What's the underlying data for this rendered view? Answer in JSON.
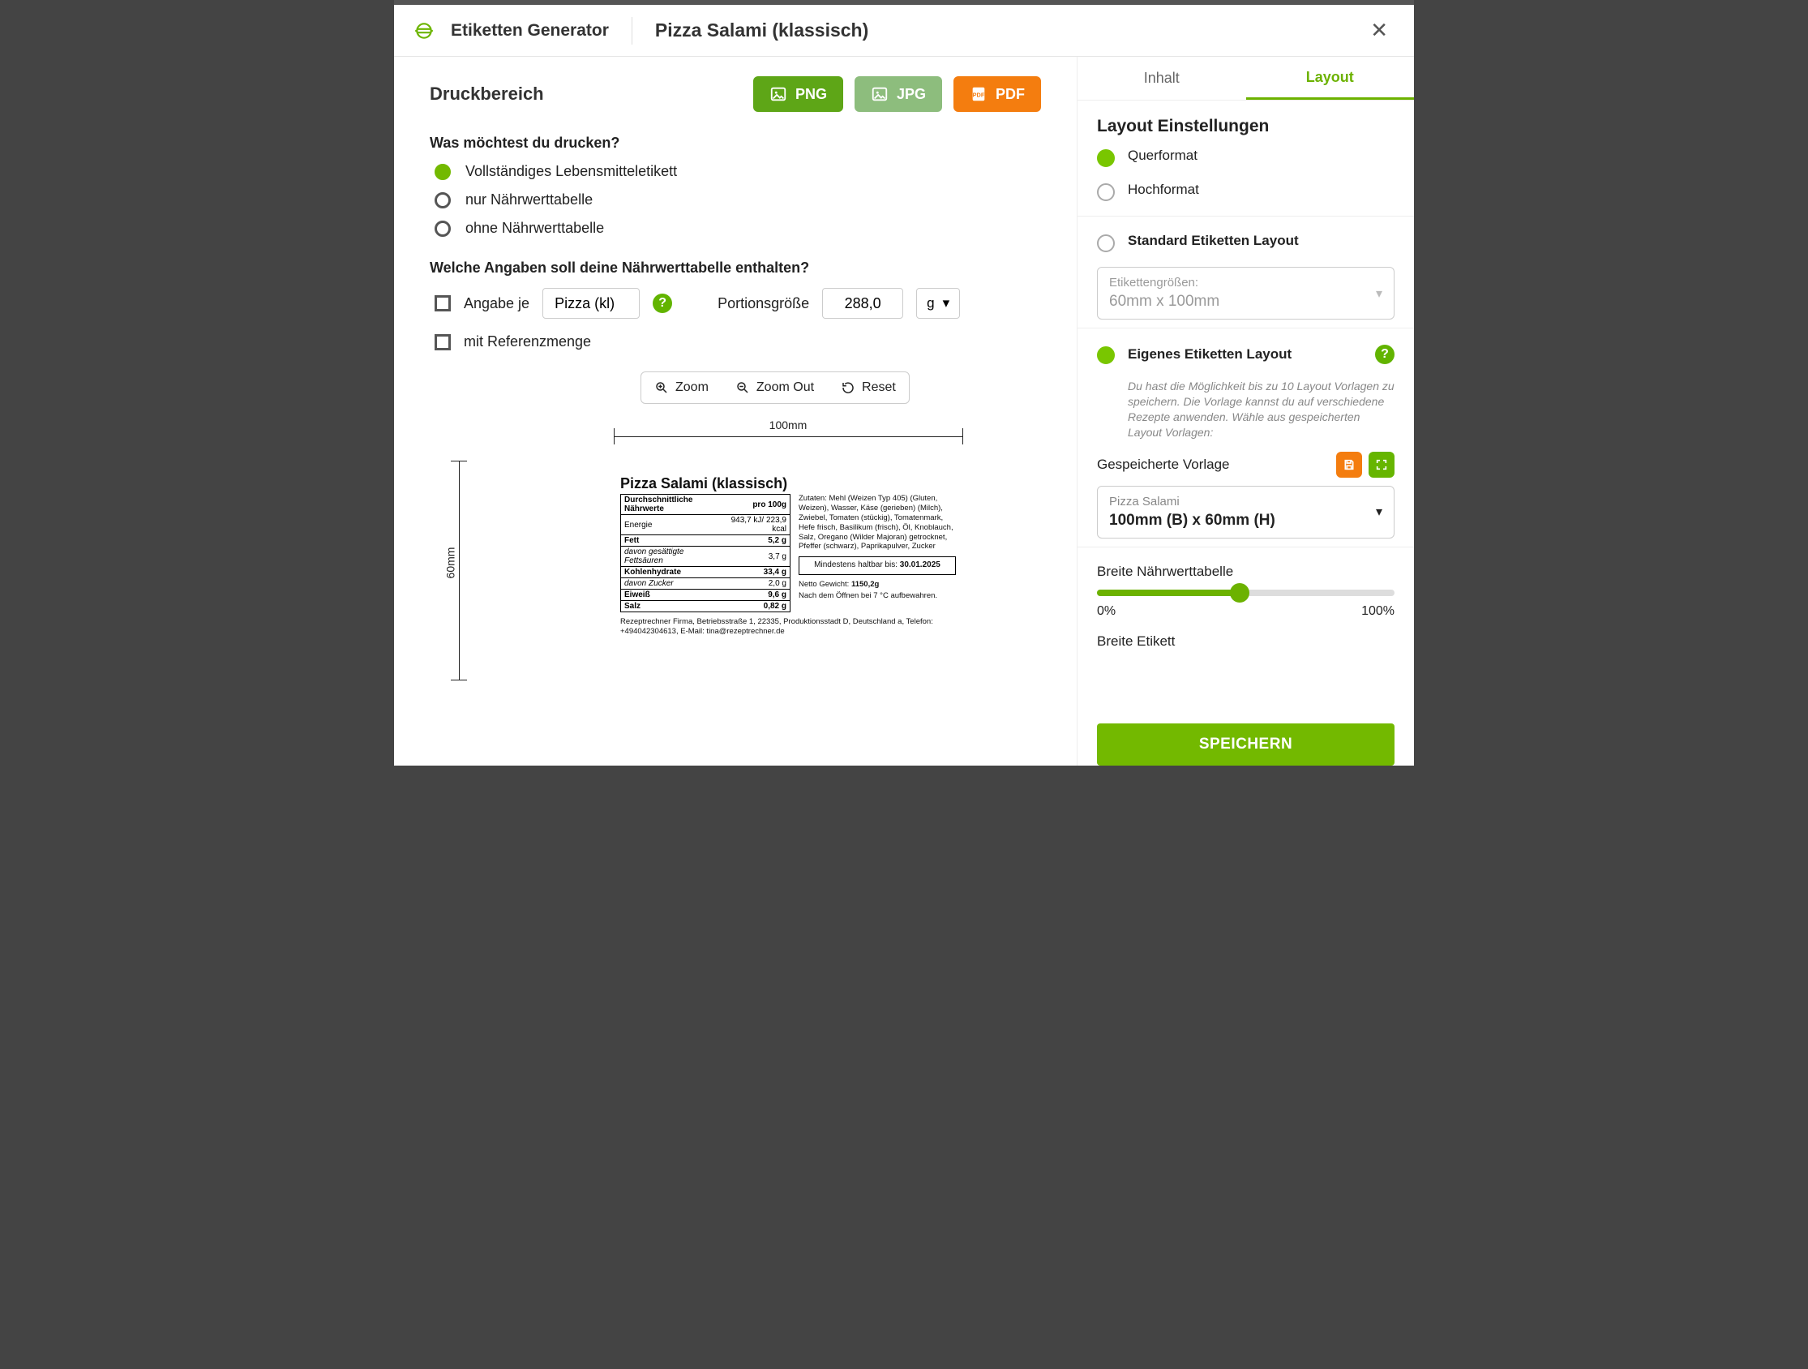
{
  "header": {
    "brand": "Etiketten Generator",
    "recipe": "Pizza Salami (klassisch)"
  },
  "left": {
    "section_title": "Druckbereich",
    "formats": {
      "png": "PNG",
      "jpg": "JPG",
      "pdf": "PDF"
    },
    "q1": {
      "title": "Was möchtest du drucken?",
      "opt_full": "Vollständiges Lebensmitteletikett",
      "opt_nut_only": "nur Nährwerttabelle",
      "opt_no_nut": "ohne Nährwerttabelle"
    },
    "q2": {
      "title": "Welche Angaben soll deine Nährwerttabelle enthalten?",
      "per_label": "Angabe je",
      "per_value": "Pizza (kl)",
      "portion_label": "Portionsgröße",
      "portion_value": "288,0",
      "unit": "g",
      "ref_label": "mit Referenzmenge"
    },
    "zoom": {
      "in": "Zoom",
      "out": "Zoom Out",
      "reset": "Reset"
    },
    "dims": {
      "w": "100mm",
      "h": "60mm"
    },
    "label": {
      "title": "Pizza Salami (klassisch)",
      "nut_header_l": "Durchschnittliche Nährwerte",
      "nut_header_r": "pro 100g",
      "rows": [
        [
          "Energie",
          "943,7 kJ/ 223,9 kcal"
        ],
        [
          "Fett",
          "5,2 g"
        ],
        [
          "davon gesättigte Fettsäuren",
          "3,7 g"
        ],
        [
          "Kohlenhydrate",
          "33,4 g"
        ],
        [
          "davon Zucker",
          "2,0 g"
        ],
        [
          "Eiweiß",
          "9,6 g"
        ],
        [
          "Salz",
          "0,82 g"
        ]
      ],
      "ingredients": "Zutaten: Mehl (Weizen Typ 405) (Gluten, Weizen), Wasser, Käse (gerieben) (Milch), Zwiebel, Tomaten (stückig), Tomatenmark, Hefe frisch, Basilikum (frisch), Öl, Knoblauch, Salz, Oregano (Wilder Majoran) getrocknet, Pfeffer (schwarz), Paprikapulver, Zucker",
      "best_by_label": "Mindestens haltbar bis:",
      "best_by_date": "30.01.2025",
      "net_weight_label": "Netto Gewicht:",
      "net_weight_value": "1150,2g",
      "opened": "Nach dem Öffnen bei 7 °C aufbewahren.",
      "address": "Rezeptrechner Firma, Betriebsstraße 1, 22335, Produktionsstadt D, Deutschland a, Telefon: +494042304613, E-Mail: tina@rezeptrechner.de"
    }
  },
  "right": {
    "tabs": {
      "content": "Inhalt",
      "layout": "Layout"
    },
    "heading": "Layout Einstellungen",
    "orient": {
      "landscape": "Querformat",
      "portrait": "Hochformat"
    },
    "std": {
      "label": "Standard Etiketten Layout",
      "sel_small": "Etikettengrößen:",
      "sel_big": "60mm x 100mm"
    },
    "own": {
      "label": "Eigenes Etiketten Layout",
      "hint": "Du hast die Möglichkeit bis zu 10 Layout Vorlagen zu speichern. Die Vorlage kannst du auf verschiedene Rezepte anwenden. Wähle aus gespeicherten Layout Vorlagen:",
      "saved_label": "Gespeicherte Vorlage",
      "saved_sel_small": "Pizza Salami",
      "saved_sel_big": "100mm (B) x 60mm (H)"
    },
    "slider1": {
      "label": "Breite Nährwerttabelle",
      "min": "0%",
      "max": "100%",
      "value_pct": 48
    },
    "slider2_label": "Breite Etikett",
    "save": "SPEICHERN"
  }
}
